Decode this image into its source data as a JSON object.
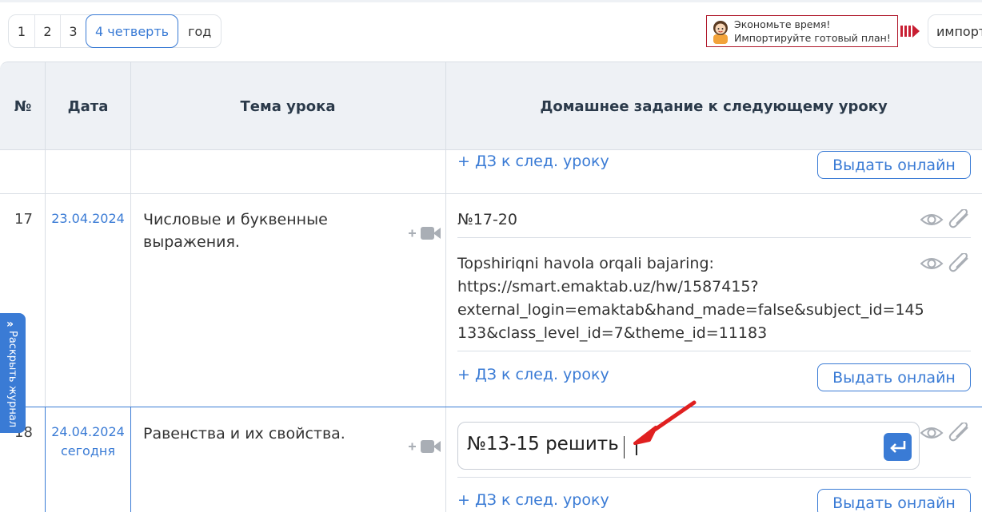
{
  "tabs": [
    {
      "label": "1"
    },
    {
      "label": "2"
    },
    {
      "label": "3"
    },
    {
      "label": "4 четверть",
      "active": true
    },
    {
      "label": "год"
    }
  ],
  "promo": {
    "line1": "Экономьте время!",
    "line2": "Импортируйте готовый план!",
    "border_color": "#b0182b"
  },
  "import_button": {
    "label": "импорт"
  },
  "table": {
    "headers": {
      "num": "№",
      "date": "Дата",
      "topic": "Тема урока",
      "homework": "Домашнее задание к следующему уроку"
    },
    "prev_row": {
      "topic_fragment": "...",
      "add_hw": "+ ДЗ к след. уроку",
      "online": "Выдать онлайн"
    },
    "rows": [
      {
        "num": "17",
        "date": "23.04.2024",
        "topic_line1": "Числовые и буквенные",
        "topic_line2": "выражения.",
        "hw1": "№17-20",
        "hw2_lines": [
          "Topshiriqni havola orqali bajaring:",
          "https://smart.emaktab.uz/hw/1587415?",
          "external_login=emaktab&hand_made=false&subject_id=145",
          "133&class_level_id=7&theme_id=11183"
        ],
        "add_hw": "+ ДЗ к след. уроку",
        "online": "Выдать онлайн"
      },
      {
        "num": "18",
        "date": "24.04.2024",
        "date_note": "сегодня",
        "topic_line1": "Равенства и их свойства.",
        "hw_input_value": "№13-15 решить",
        "add_hw": "+ ДЗ к след. уроку",
        "online": "Выдать онлайн"
      }
    ]
  },
  "side_tab": {
    "label": "Раскрыть журнал"
  },
  "colors": {
    "accent": "#3a7bd5",
    "header_bg": "#eef1f5",
    "annotation_arrow": "#e02020"
  },
  "icons": [
    "eye-icon",
    "paperclip-icon",
    "video-camera-icon",
    "enter-icon",
    "chevron-double-right-icon"
  ]
}
